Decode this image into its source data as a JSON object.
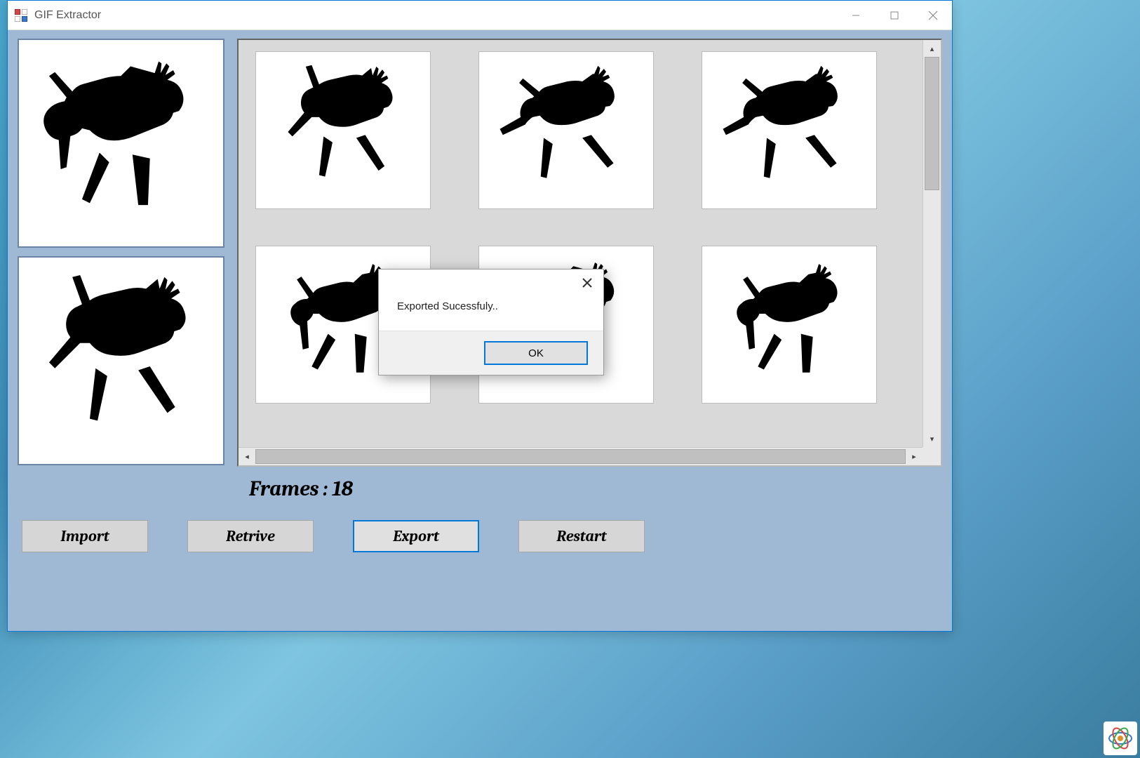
{
  "window": {
    "title": "GIF Extractor"
  },
  "framesLabel": "Frames : 18",
  "buttons": {
    "import": "Import",
    "retrive": "Retrive",
    "export": "Export",
    "restart": "Restart"
  },
  "dialog": {
    "message": "Exported Sucessfuly..",
    "ok": "OK"
  },
  "icons": {
    "app": "winforms-app-icon",
    "minimize": "minimize-icon",
    "maximize": "maximize-icon",
    "close": "close-icon",
    "tray": "logo-icon"
  },
  "frames": {
    "count": 18,
    "previewTop": "deer-frame-pose-a",
    "previewBottom": "deer-frame-pose-b",
    "thumbs": [
      "deer-frame-1",
      "deer-frame-2",
      "deer-frame-3",
      "deer-frame-4",
      "deer-frame-5",
      "deer-frame-6"
    ]
  }
}
